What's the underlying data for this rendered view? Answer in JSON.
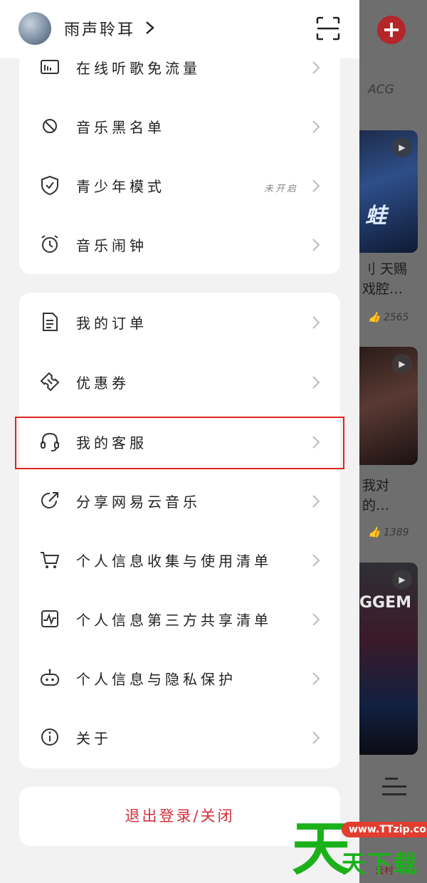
{
  "background": {
    "tab_label": "ACG",
    "cards": [
      {
        "title": "刂 天赐\n戏腔…",
        "likes": "2565"
      },
      {
        "title": "我对\n的…",
        "likes": "1389"
      },
      {
        "title": "",
        "likes": ""
      }
    ],
    "card1_overlay": "蛙",
    "card3_overlay": "GGEM",
    "bottom_text": "云村"
  },
  "header": {
    "username": "雨声聆耳",
    "avatar_icon": "avatar",
    "scan_icon": "scan-icon"
  },
  "menu_group_1": [
    {
      "label": "在线听歌免流量",
      "icon": "sim-card-icon",
      "status": ""
    },
    {
      "label": "音乐黑名单",
      "icon": "block-icon",
      "status": ""
    },
    {
      "label": "青少年模式",
      "icon": "shield-check-icon",
      "status": "未开启"
    },
    {
      "label": "音乐闹钟",
      "icon": "alarm-clock-icon",
      "status": ""
    }
  ],
  "menu_group_2": [
    {
      "label": "我的订单",
      "icon": "document-icon"
    },
    {
      "label": "优惠券",
      "icon": "ticket-icon"
    },
    {
      "label": "我的客服",
      "icon": "headset-icon"
    },
    {
      "label": "分享网易云音乐",
      "icon": "share-icon"
    },
    {
      "label": "个人信息收集与使用清单",
      "icon": "cart-icon"
    },
    {
      "label": "个人信息第三方共享清单",
      "icon": "chart-icon"
    },
    {
      "label": "个人信息与隐私保护",
      "icon": "robot-icon"
    },
    {
      "label": "关于",
      "icon": "info-icon"
    }
  ],
  "logout_label": "退出登录/关闭",
  "watermark": {
    "big": "天",
    "url": "www.TTzip.com",
    "small": "天下载"
  },
  "colors": {
    "accent_red": "#d3303b",
    "highlight_red": "#e1251b",
    "watermark_green": "#1bb11b"
  }
}
